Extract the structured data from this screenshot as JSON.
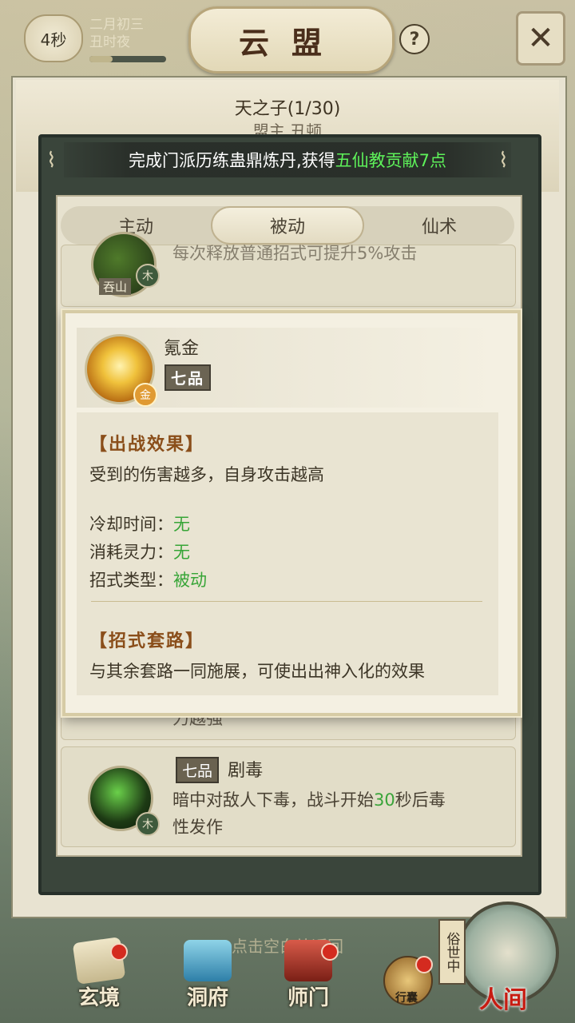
{
  "topbar": {
    "timer": "4秒",
    "date_line1": "二月初三",
    "date_line2": "丑时夜",
    "title": "云盟",
    "help": "?",
    "close": "✕"
  },
  "header": {
    "title": "天之子(1/30)",
    "subtitle": "盟主 丑顿"
  },
  "notice": {
    "prefix": "完成门派历练蛊鼎炼丹,获得",
    "highlight": "五仙教贡献7点"
  },
  "tabs": [
    {
      "label": "主动",
      "active": false
    },
    {
      "label": "被动",
      "active": true
    },
    {
      "label": "仙术",
      "active": false
    }
  ],
  "list": {
    "item1_partial": "每次释放普通招式可提升5%攻击",
    "item1_orb_label": "吞山",
    "item1_element": "木",
    "item2_partial": "力越强",
    "item3": {
      "grade": "七品",
      "name": "剧毒",
      "desc_before": "暗中对敌人下毒，战斗开始",
      "desc_num": "30",
      "desc_after": "秒后毒",
      "desc_line2": "性发作",
      "element": "木"
    }
  },
  "popup": {
    "skill_name": "氪金",
    "grade": "七品",
    "element": "金",
    "section1_title": "【出战效果】",
    "effect": "受到的伤害越多，自身攻击越高",
    "cooldown_label": "冷却时间：",
    "cooldown_value": "无",
    "cost_label": "消耗灵力：",
    "cost_value": "无",
    "type_label": "招式类型：",
    "type_value": "被动",
    "section2_title": "【招式套路】",
    "combo": "与其余套路一同施展，可使出出神入化的效果"
  },
  "hint": "点击空白处返回",
  "nav": [
    {
      "label": "玄境",
      "badge": true
    },
    {
      "label": "洞府",
      "badge": false
    },
    {
      "label": "师门",
      "badge": true
    }
  ],
  "bag_label": "行囊",
  "world": {
    "tag": "俗世中",
    "label": "人间"
  },
  "colors": {
    "highlight_green": "#5ef25a",
    "value_green": "#37a537",
    "section_brown": "#8a4e1a",
    "world_red": "#c71c12"
  }
}
